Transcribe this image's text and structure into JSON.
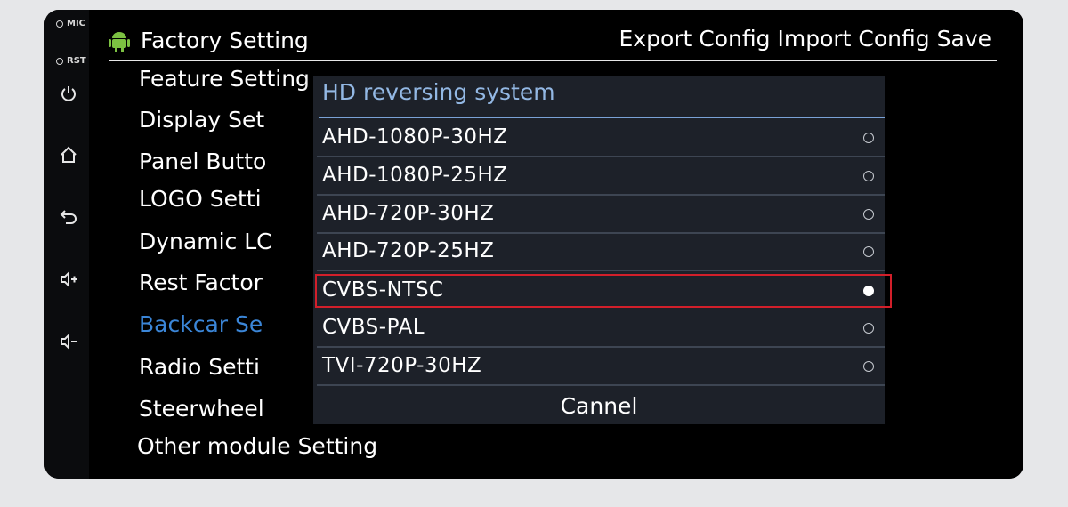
{
  "side": {
    "mic_label": "MIC",
    "rst_label": "RST",
    "buttons": [
      "power-icon",
      "home-icon",
      "back-icon",
      "volume-up-icon",
      "volume-down-icon"
    ]
  },
  "header": {
    "title": "Factory Setting",
    "actions": [
      "Export Config",
      "Import Config",
      "Save"
    ]
  },
  "menu": {
    "items": [
      "Feature Setting",
      "Display Set",
      "Panel Butto",
      "LOGO Setti",
      "Dynamic LC",
      "Rest Factor",
      "Backcar Se",
      "Radio Setti",
      "Steerwheel",
      "Other module Setting"
    ],
    "active_index": 6
  },
  "dialog": {
    "title": "HD reversing system",
    "options": [
      "AHD-1080P-30HZ",
      "AHD-1080P-25HZ",
      "AHD-720P-30HZ",
      "AHD-720P-25HZ",
      "CVBS-NTSC",
      "CVBS-PAL",
      "TVI-720P-30HZ"
    ],
    "selected_index": 4,
    "cancel_label": "Cannel"
  },
  "colors": {
    "active_menu": "#3b86d8",
    "dialog_title": "#93b8e4",
    "highlight_border": "#d21f2a",
    "dialog_bg": "#1d2129"
  }
}
